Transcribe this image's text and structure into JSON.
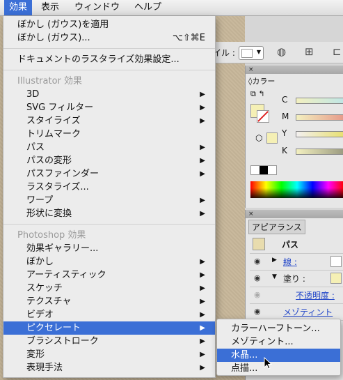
{
  "menubar": {
    "items": [
      "効果",
      "表示",
      "ウィンドウ",
      "ヘルプ"
    ]
  },
  "control_bar": {
    "style_label": "イル :"
  },
  "color_panel": {
    "close": "×",
    "tab": "◊カラー",
    "channels": [
      "C",
      "M",
      "Y",
      "K"
    ]
  },
  "appearance_panel": {
    "close": "×",
    "tab": "アピアランス",
    "object": "パス",
    "stroke_label": "線 :",
    "fill_label": "塗り :",
    "opacity_label": "不透明度 :",
    "effect_label": "メゾティント"
  },
  "menu": {
    "apply_last": "ぼかし (ガウス)を適用",
    "last_effect": "ぼかし (ガウス)...",
    "last_effect_shortcut": "⌥⇧⌘E",
    "raster_settings": "ドキュメントのラスタライズ効果設定...",
    "illustrator_header": "Illustrator 効果",
    "illustrator_items": [
      "3D",
      "SVG フィルター",
      "スタイライズ",
      "トリムマーク",
      "パス",
      "パスの変形",
      "パスファインダー",
      "ラスタライズ...",
      "ワープ",
      "形状に変換"
    ],
    "photoshop_header": "Photoshop 効果",
    "photoshop_items": [
      "効果ギャラリー...",
      "ぼかし",
      "アーティスティック",
      "スケッチ",
      "テクスチャ",
      "ビデオ",
      "ピクセレート",
      "ブラシストローク",
      "変形",
      "表現手法"
    ]
  },
  "submenu": {
    "items": [
      "カラーハーフトーン...",
      "メゾティント...",
      "水晶...",
      "点描..."
    ],
    "highlighted": "水晶..."
  },
  "colors": {
    "highlight": "#3b6fd6",
    "link": "#2347c9",
    "menu_bg": "#ececec"
  }
}
